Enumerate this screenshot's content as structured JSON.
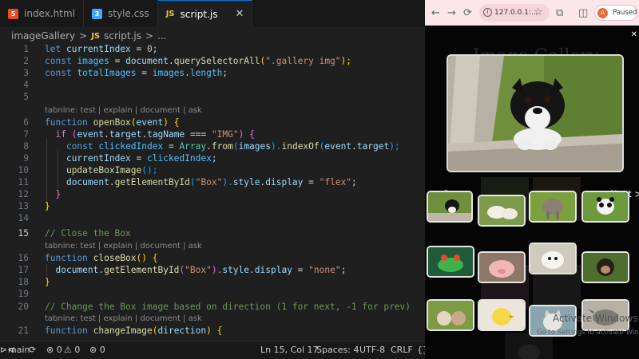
{
  "tabs": [
    {
      "label": "index.html",
      "icon": "html5-icon",
      "active": false
    },
    {
      "label": "style.css",
      "icon": "css3-icon",
      "active": false
    },
    {
      "label": "script.js",
      "icon": "js-icon",
      "active": true
    }
  ],
  "tab_icons": {
    "html": "5",
    "css": "3",
    "js": "JS"
  },
  "close_glyph": "✕",
  "breadcrumb": {
    "folder": "imageGallery",
    "sep1": ">",
    "file_icon": "JS",
    "file": "script.js",
    "sep2": ">",
    "more": "..."
  },
  "code": {
    "hint": "tabnine: test | explain | document | ask",
    "line_numbers": [
      "1",
      "2",
      "3",
      "4",
      "5",
      "6",
      "7",
      "8",
      "9",
      "10",
      "11",
      "12",
      "13",
      "14",
      "15",
      "16",
      "17",
      "18",
      "19",
      "20",
      "21"
    ],
    "l1": [
      "let",
      "currentIndex",
      " = ",
      "0",
      ";"
    ],
    "l2": [
      "const",
      "images",
      " = ",
      "document",
      ".",
      "querySelectorAll",
      "(",
      "\".gallery img\"",
      ");"
    ],
    "l3": [
      "const",
      "totalImages",
      " = ",
      "images",
      ".",
      "length",
      ";"
    ],
    "l6": [
      "function",
      "openBox",
      "(",
      "event",
      ") {"
    ],
    "l7": [
      "if",
      "(",
      "event",
      ".",
      "target",
      ".",
      "tagName",
      " === ",
      "\"IMG\"",
      ") {"
    ],
    "l8": [
      "const",
      "clickedIndex",
      " = ",
      "Array",
      ".",
      "from",
      "(",
      "images",
      ").",
      "indexOf",
      "(",
      "event",
      ".",
      "target",
      ");"
    ],
    "l9": [
      "currentIndex",
      " = ",
      "clickedIndex",
      ";"
    ],
    "l10": [
      "updateBoxImage",
      "();"
    ],
    "l11": [
      "document",
      ".",
      "getElementById",
      "(",
      "\"Box\"",
      ").",
      "style",
      ".",
      "display",
      " = ",
      "\"flex\"",
      ";"
    ],
    "l12": [
      "}"
    ],
    "l13": [
      "}"
    ],
    "l15": "// Close the Box",
    "l16": [
      "function",
      "closeBox",
      "() {"
    ],
    "l17": [
      "document",
      ".",
      "getElementById",
      "(",
      "\"Box\"",
      ").",
      "style",
      ".",
      "display",
      " = ",
      "\"none\"",
      ";"
    ],
    "l18": [
      "}"
    ],
    "l20": "// Change the Box image based on direction (1 for next, -1 for prev)",
    "l21": [
      "function",
      "changeImage",
      "(",
      "direction",
      ") {"
    ]
  },
  "status": {
    "remote": "⊳⊲",
    "branch": "main",
    "sync": "⟳",
    "errors": "⊗ 0",
    "warnings": "⚠ 0",
    "ports": "⊛ 0",
    "position": "Ln 15, Col 17",
    "spaces": "Spaces: 4",
    "encoding": "UTF-8",
    "eol": "CRLF",
    "lang": "{}"
  },
  "browser": {
    "back": "←",
    "forward": "→",
    "reload": "⟳",
    "url": "127.0.0.1:...",
    "info": "i",
    "star": "☆",
    "extensions": "⧉",
    "sidebar": "◫",
    "profile_initial": "A",
    "profile_status": "Paused",
    "page_title": "Image Gallery",
    "close": "✕",
    "prev": "< Prev",
    "next": "Next >",
    "watermark_title": "Activate Windows",
    "watermark_sub": "Go to Settings to activate Windows."
  },
  "colors": {
    "accent": "#0078d4",
    "editor_bg": "#1f1f1f",
    "browser_chrome": "#fce6ea"
  }
}
